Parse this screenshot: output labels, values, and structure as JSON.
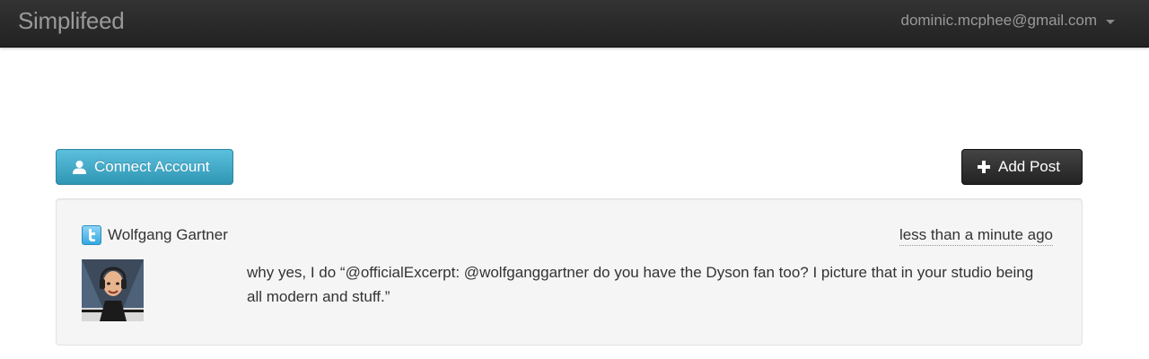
{
  "navbar": {
    "brand": "Simplifeed",
    "user_email": "dominic.mcphee@gmail.com"
  },
  "toolbar": {
    "connect_label": "Connect Account",
    "add_post_label": "Add Post"
  },
  "posts": [
    {
      "network_icon": "twitter-icon",
      "author": "Wolfgang Gartner",
      "time": "less than a minute ago",
      "text": "why yes, I do “@officialExcerpt: @wolfganggartner do you have the Dyson fan too? I picture that in your studio being all modern and stuff.”"
    }
  ],
  "colors": {
    "navbar": "#222222",
    "info_button": "#49afcd",
    "inverse_button": "#333333",
    "card_background": "#f5f5f5"
  }
}
